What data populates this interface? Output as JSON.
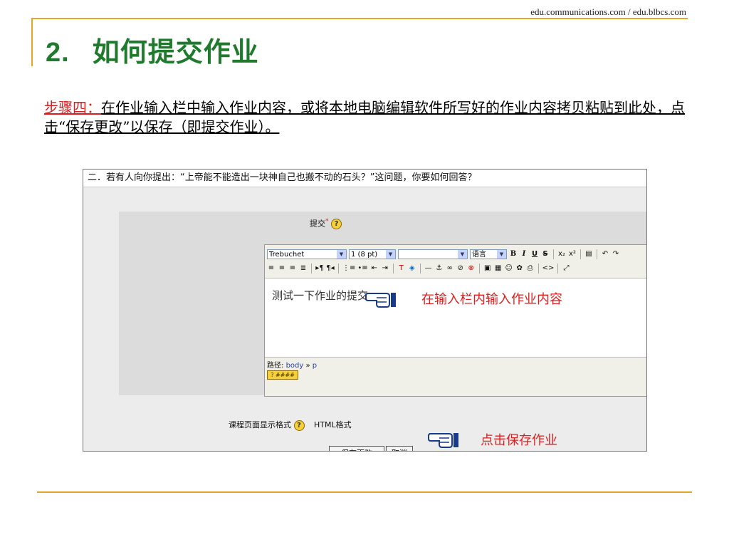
{
  "header": {
    "url": "edu.communications.com / edu.blbcs.com",
    "number": "2.",
    "title": "如何提交作业"
  },
  "step": {
    "heading": "步骤四：",
    "text": "在作业输入栏中输入作业内容，或将本地电脑编辑软件所写好的作业内容拷贝粘贴到此处，点击“保存更改”以保存（即提交作业）。"
  },
  "screenshot": {
    "question": "二．若有人向你提出：“上帝能不能造出一块神自己也搬不动的石头？”这问题，你要如何回答？",
    "submit_label": "提交",
    "required_mark": "*",
    "toolbar": {
      "font": "Trebuchet",
      "size": "1 (8 pt)",
      "format": "",
      "language": "语言",
      "bold": "B",
      "italic": "I",
      "underline": "U",
      "strike": "S",
      "subscript": "x₂",
      "superscript": "x²",
      "undo": "↶",
      "redo": "↷",
      "html": "<>"
    },
    "content": "测试一下作业的提交",
    "path_label": "路径:",
    "path_body": "body",
    "path_sep": "»",
    "path_p": "p",
    "keyboard_label": "? ####",
    "format_label": "课程页面显示格式",
    "format_value": "HTML格式",
    "save_button": "保存更改",
    "cancel_button": "取消"
  },
  "annotations": {
    "input_note": "在输入栏内输入作业内容",
    "save_note": "点击保存作业"
  },
  "colors": {
    "accent": "#e5a52b",
    "title": "#1f7a2e",
    "note": "#e02020"
  },
  "icons": [
    "help-icon",
    "pointing-hand-icon"
  ]
}
